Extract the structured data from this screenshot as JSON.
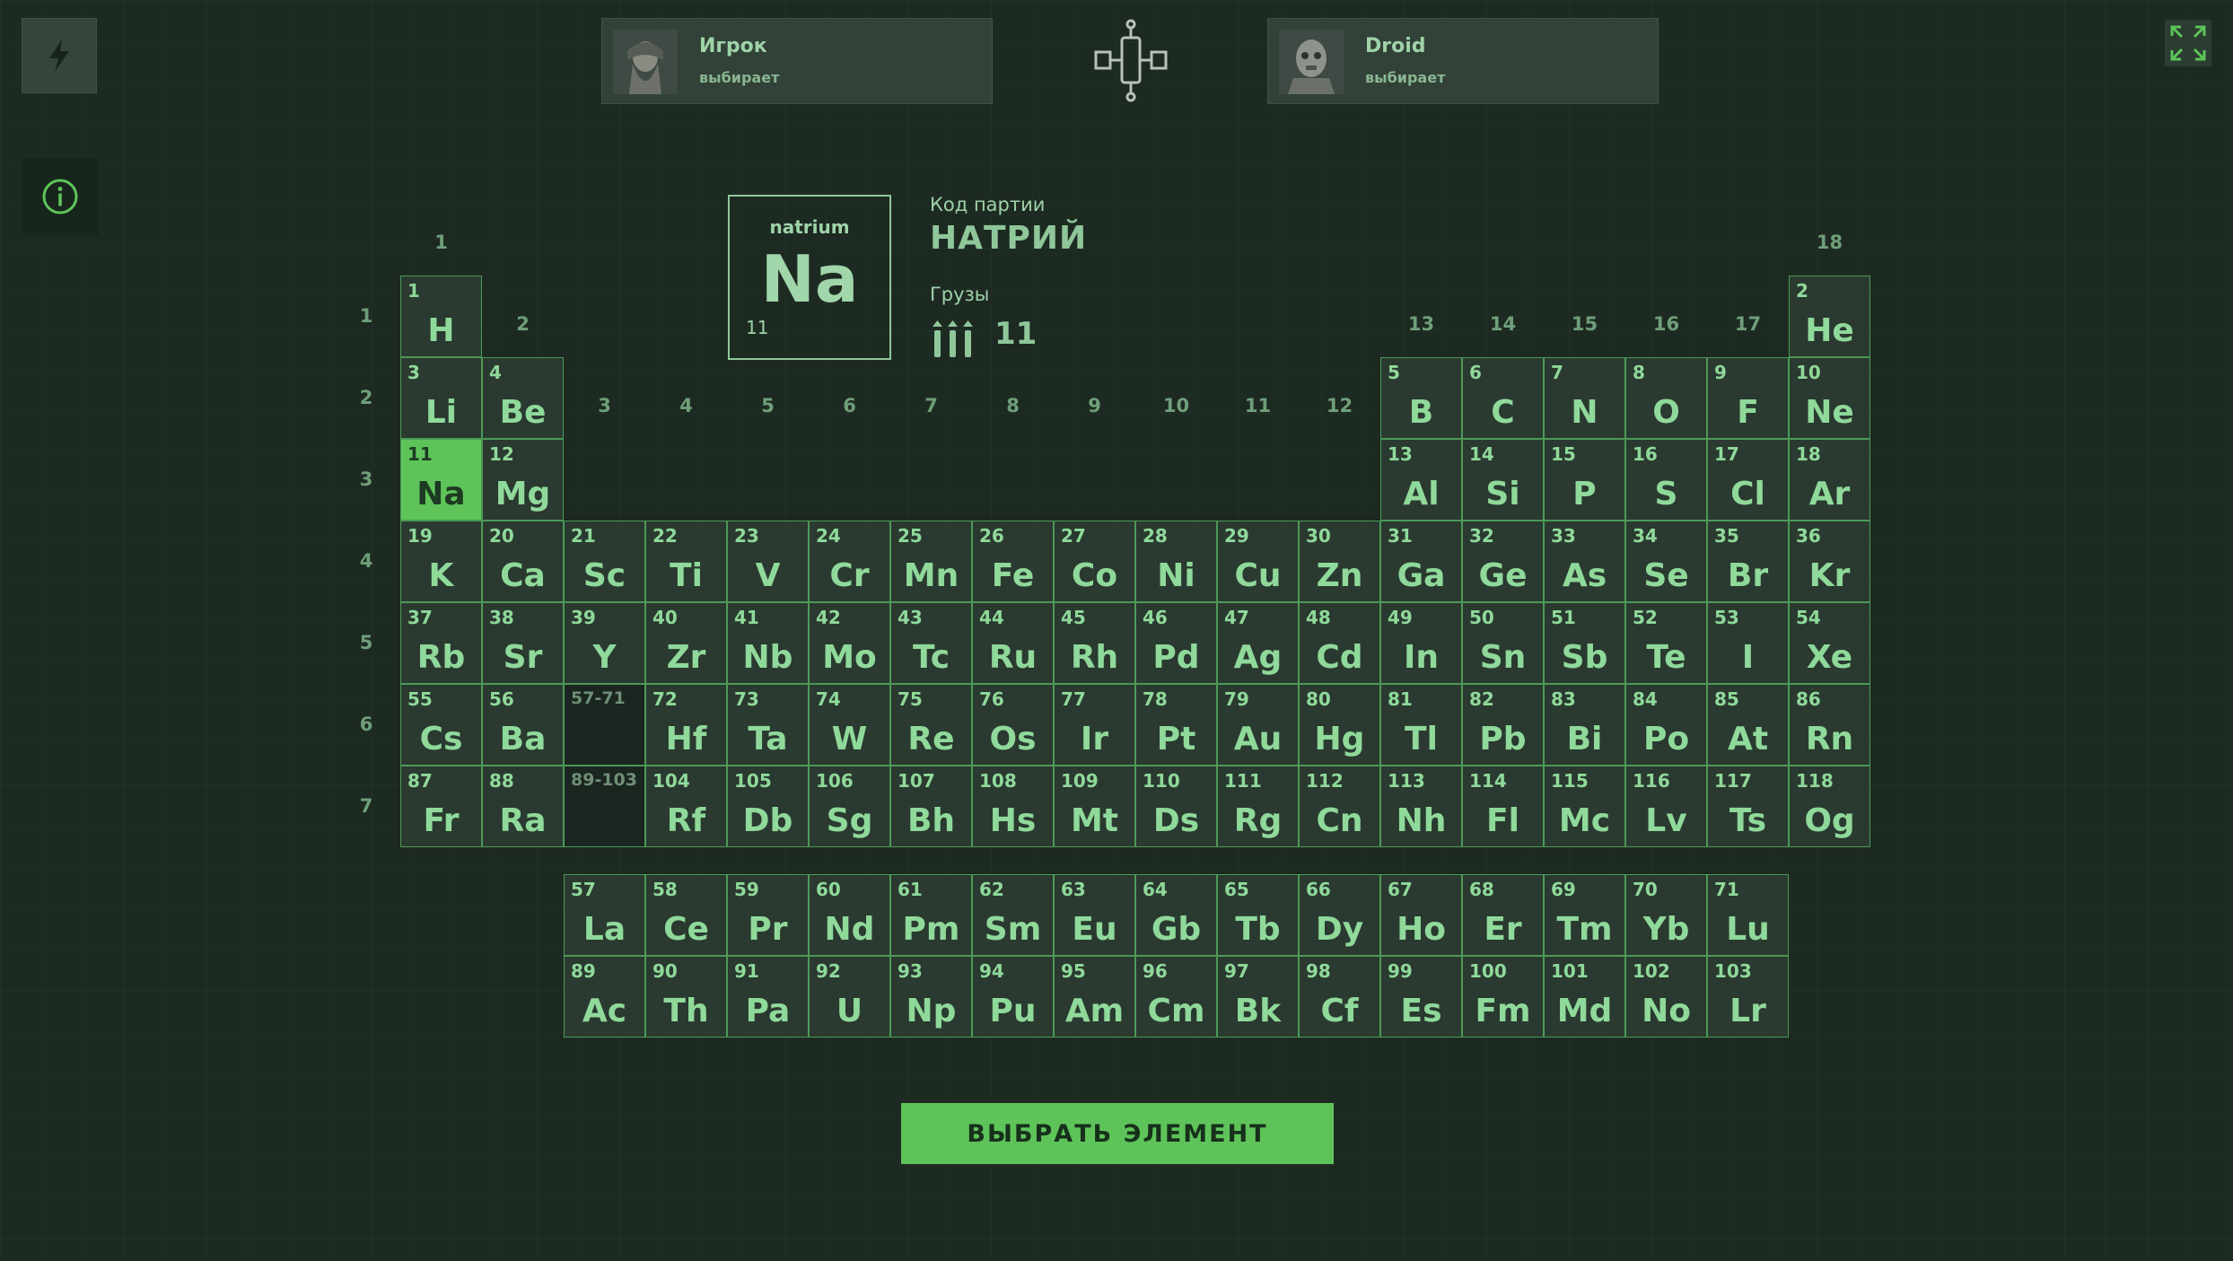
{
  "players": [
    {
      "name": "Игрок",
      "status": "выбирает"
    },
    {
      "name": "Droid",
      "status": "выбирает"
    }
  ],
  "selected": {
    "latin_name": "natrium",
    "symbol": "Na",
    "number": "11",
    "code_label": "Код партии",
    "russian_name": "НАТРИЙ",
    "cargo_label": "Грузы",
    "cargo_value": "11"
  },
  "group_labels": [
    "1",
    "2",
    "3",
    "4",
    "5",
    "6",
    "7",
    "8",
    "9",
    "10",
    "11",
    "12",
    "13",
    "14",
    "15",
    "16",
    "17",
    "18"
  ],
  "period_labels": [
    "1",
    "2",
    "3",
    "4",
    "5",
    "6",
    "7"
  ],
  "elements": [
    {
      "n": "1",
      "s": "H",
      "col": 1,
      "row": 1
    },
    {
      "n": "2",
      "s": "He",
      "col": 18,
      "row": 1
    },
    {
      "n": "3",
      "s": "Li",
      "col": 1,
      "row": 2
    },
    {
      "n": "4",
      "s": "Be",
      "col": 2,
      "row": 2
    },
    {
      "n": "5",
      "s": "B",
      "col": 13,
      "row": 2
    },
    {
      "n": "6",
      "s": "C",
      "col": 14,
      "row": 2
    },
    {
      "n": "7",
      "s": "N",
      "col": 15,
      "row": 2
    },
    {
      "n": "8",
      "s": "O",
      "col": 16,
      "row": 2
    },
    {
      "n": "9",
      "s": "F",
      "col": 17,
      "row": 2
    },
    {
      "n": "10",
      "s": "Ne",
      "col": 18,
      "row": 2
    },
    {
      "n": "11",
      "s": "Na",
      "col": 1,
      "row": 3,
      "sel": true
    },
    {
      "n": "12",
      "s": "Mg",
      "col": 2,
      "row": 3
    },
    {
      "n": "13",
      "s": "Al",
      "col": 13,
      "row": 3
    },
    {
      "n": "14",
      "s": "Si",
      "col": 14,
      "row": 3
    },
    {
      "n": "15",
      "s": "P",
      "col": 15,
      "row": 3
    },
    {
      "n": "16",
      "s": "S",
      "col": 16,
      "row": 3
    },
    {
      "n": "17",
      "s": "Cl",
      "col": 17,
      "row": 3
    },
    {
      "n": "18",
      "s": "Ar",
      "col": 18,
      "row": 3
    },
    {
      "n": "19",
      "s": "K",
      "col": 1,
      "row": 4
    },
    {
      "n": "20",
      "s": "Ca",
      "col": 2,
      "row": 4
    },
    {
      "n": "21",
      "s": "Sc",
      "col": 3,
      "row": 4
    },
    {
      "n": "22",
      "s": "Ti",
      "col": 4,
      "row": 4
    },
    {
      "n": "23",
      "s": "V",
      "col": 5,
      "row": 4
    },
    {
      "n": "24",
      "s": "Cr",
      "col": 6,
      "row": 4
    },
    {
      "n": "25",
      "s": "Mn",
      "col": 7,
      "row": 4
    },
    {
      "n": "26",
      "s": "Fe",
      "col": 8,
      "row": 4
    },
    {
      "n": "27",
      "s": "Co",
      "col": 9,
      "row": 4
    },
    {
      "n": "28",
      "s": "Ni",
      "col": 10,
      "row": 4
    },
    {
      "n": "29",
      "s": "Cu",
      "col": 11,
      "row": 4
    },
    {
      "n": "30",
      "s": "Zn",
      "col": 12,
      "row": 4
    },
    {
      "n": "31",
      "s": "Ga",
      "col": 13,
      "row": 4
    },
    {
      "n": "32",
      "s": "Ge",
      "col": 14,
      "row": 4
    },
    {
      "n": "33",
      "s": "As",
      "col": 15,
      "row": 4
    },
    {
      "n": "34",
      "s": "Se",
      "col": 16,
      "row": 4
    },
    {
      "n": "35",
      "s": "Br",
      "col": 17,
      "row": 4
    },
    {
      "n": "36",
      "s": "Kr",
      "col": 18,
      "row": 4
    },
    {
      "n": "37",
      "s": "Rb",
      "col": 1,
      "row": 5
    },
    {
      "n": "38",
      "s": "Sr",
      "col": 2,
      "row": 5
    },
    {
      "n": "39",
      "s": "Y",
      "col": 3,
      "row": 5
    },
    {
      "n": "40",
      "s": "Zr",
      "col": 4,
      "row": 5
    },
    {
      "n": "41",
      "s": "Nb",
      "col": 5,
      "row": 5
    },
    {
      "n": "42",
      "s": "Mo",
      "col": 6,
      "row": 5
    },
    {
      "n": "43",
      "s": "Tc",
      "col": 7,
      "row": 5
    },
    {
      "n": "44",
      "s": "Ru",
      "col": 8,
      "row": 5
    },
    {
      "n": "45",
      "s": "Rh",
      "col": 9,
      "row": 5
    },
    {
      "n": "46",
      "s": "Pd",
      "col": 10,
      "row": 5
    },
    {
      "n": "47",
      "s": "Ag",
      "col": 11,
      "row": 5
    },
    {
      "n": "48",
      "s": "Cd",
      "col": 12,
      "row": 5
    },
    {
      "n": "49",
      "s": "In",
      "col": 13,
      "row": 5
    },
    {
      "n": "50",
      "s": "Sn",
      "col": 14,
      "row": 5
    },
    {
      "n": "51",
      "s": "Sb",
      "col": 15,
      "row": 5
    },
    {
      "n": "52",
      "s": "Te",
      "col": 16,
      "row": 5
    },
    {
      "n": "53",
      "s": "I",
      "col": 17,
      "row": 5
    },
    {
      "n": "54",
      "s": "Xe",
      "col": 18,
      "row": 5
    },
    {
      "n": "55",
      "s": "Cs",
      "col": 1,
      "row": 6
    },
    {
      "n": "56",
      "s": "Ba",
      "col": 2,
      "row": 6
    },
    {
      "n": "57-71",
      "s": "",
      "col": 3,
      "row": 6,
      "empty": true
    },
    {
      "n": "72",
      "s": "Hf",
      "col": 4,
      "row": 6
    },
    {
      "n": "73",
      "s": "Ta",
      "col": 5,
      "row": 6
    },
    {
      "n": "74",
      "s": "W",
      "col": 6,
      "row": 6
    },
    {
      "n": "75",
      "s": "Re",
      "col": 7,
      "row": 6
    },
    {
      "n": "76",
      "s": "Os",
      "col": 8,
      "row": 6
    },
    {
      "n": "77",
      "s": "Ir",
      "col": 9,
      "row": 6
    },
    {
      "n": "78",
      "s": "Pt",
      "col": 10,
      "row": 6
    },
    {
      "n": "79",
      "s": "Au",
      "col": 11,
      "row": 6
    },
    {
      "n": "80",
      "s": "Hg",
      "col": 12,
      "row": 6
    },
    {
      "n": "81",
      "s": "Tl",
      "col": 13,
      "row": 6
    },
    {
      "n": "82",
      "s": "Pb",
      "col": 14,
      "row": 6
    },
    {
      "n": "83",
      "s": "Bi",
      "col": 15,
      "row": 6
    },
    {
      "n": "84",
      "s": "Po",
      "col": 16,
      "row": 6
    },
    {
      "n": "85",
      "s": "At",
      "col": 17,
      "row": 6
    },
    {
      "n": "86",
      "s": "Rn",
      "col": 18,
      "row": 6
    },
    {
      "n": "87",
      "s": "Fr",
      "col": 1,
      "row": 7
    },
    {
      "n": "88",
      "s": "Ra",
      "col": 2,
      "row": 7
    },
    {
      "n": "89-103",
      "s": "",
      "col": 3,
      "row": 7,
      "empty": true
    },
    {
      "n": "104",
      "s": "Rf",
      "col": 4,
      "row": 7
    },
    {
      "n": "105",
      "s": "Db",
      "col": 5,
      "row": 7
    },
    {
      "n": "106",
      "s": "Sg",
      "col": 6,
      "row": 7
    },
    {
      "n": "107",
      "s": "Bh",
      "col": 7,
      "row": 7
    },
    {
      "n": "108",
      "s": "Hs",
      "col": 8,
      "row": 7
    },
    {
      "n": "109",
      "s": "Mt",
      "col": 9,
      "row": 7
    },
    {
      "n": "110",
      "s": "Ds",
      "col": 10,
      "row": 7
    },
    {
      "n": "111",
      "s": "Rg",
      "col": 11,
      "row": 7
    },
    {
      "n": "112",
      "s": "Cn",
      "col": 12,
      "row": 7
    },
    {
      "n": "113",
      "s": "Nh",
      "col": 13,
      "row": 7
    },
    {
      "n": "114",
      "s": "Fl",
      "col": 14,
      "row": 7
    },
    {
      "n": "115",
      "s": "Mc",
      "col": 15,
      "row": 7
    },
    {
      "n": "116",
      "s": "Lv",
      "col": 16,
      "row": 7
    },
    {
      "n": "117",
      "s": "Ts",
      "col": 17,
      "row": 7
    },
    {
      "n": "118",
      "s": "Og",
      "col": 18,
      "row": 7
    },
    {
      "n": "57",
      "s": "La",
      "col": 3,
      "row": 8
    },
    {
      "n": "58",
      "s": "Ce",
      "col": 4,
      "row": 8
    },
    {
      "n": "59",
      "s": "Pr",
      "col": 5,
      "row": 8
    },
    {
      "n": "60",
      "s": "Nd",
      "col": 6,
      "row": 8
    },
    {
      "n": "61",
      "s": "Pm",
      "col": 7,
      "row": 8
    },
    {
      "n": "62",
      "s": "Sm",
      "col": 8,
      "row": 8
    },
    {
      "n": "63",
      "s": "Eu",
      "col": 9,
      "row": 8
    },
    {
      "n": "64",
      "s": "Gb",
      "col": 10,
      "row": 8
    },
    {
      "n": "65",
      "s": "Tb",
      "col": 11,
      "row": 8
    },
    {
      "n": "66",
      "s": "Dy",
      "col": 12,
      "row": 8
    },
    {
      "n": "67",
      "s": "Ho",
      "col": 13,
      "row": 8
    },
    {
      "n": "68",
      "s": "Er",
      "col": 14,
      "row": 8
    },
    {
      "n": "69",
      "s": "Tm",
      "col": 15,
      "row": 8
    },
    {
      "n": "70",
      "s": "Yb",
      "col": 16,
      "row": 8
    },
    {
      "n": "71",
      "s": "Lu",
      "col": 17,
      "row": 8
    },
    {
      "n": "89",
      "s": "Ac",
      "col": 3,
      "row": 9
    },
    {
      "n": "90",
      "s": "Th",
      "col": 4,
      "row": 9
    },
    {
      "n": "91",
      "s": "Pa",
      "col": 5,
      "row": 9
    },
    {
      "n": "92",
      "s": "U",
      "col": 6,
      "row": 9
    },
    {
      "n": "93",
      "s": "Np",
      "col": 7,
      "row": 9
    },
    {
      "n": "94",
      "s": "Pu",
      "col": 8,
      "row": 9
    },
    {
      "n": "95",
      "s": "Am",
      "col": 9,
      "row": 9
    },
    {
      "n": "96",
      "s": "Cm",
      "col": 10,
      "row": 9
    },
    {
      "n": "97",
      "s": "Bk",
      "col": 11,
      "row": 9
    },
    {
      "n": "98",
      "s": "Cf",
      "col": 12,
      "row": 9
    },
    {
      "n": "99",
      "s": "Es",
      "col": 13,
      "row": 9
    },
    {
      "n": "100",
      "s": "Fm",
      "col": 14,
      "row": 9
    },
    {
      "n": "101",
      "s": "Md",
      "col": 15,
      "row": 9
    },
    {
      "n": "102",
      "s": "No",
      "col": 16,
      "row": 9
    },
    {
      "n": "103",
      "s": "Lr",
      "col": 17,
      "row": 9
    }
  ],
  "choose_button": "ВЫБРАТЬ ЭЛЕМЕНТ",
  "colors": {
    "background": "#1d2a22",
    "accent": "#5ec45a",
    "cell_text": "#8fd99a",
    "cell_border": "#4c9a57"
  },
  "icons": {
    "top_left": "bolt-icon",
    "info": "info-icon",
    "fullscreen": "fullscreen-icon",
    "logo": "game-logo-icon",
    "cargo": "cargo-icon"
  }
}
